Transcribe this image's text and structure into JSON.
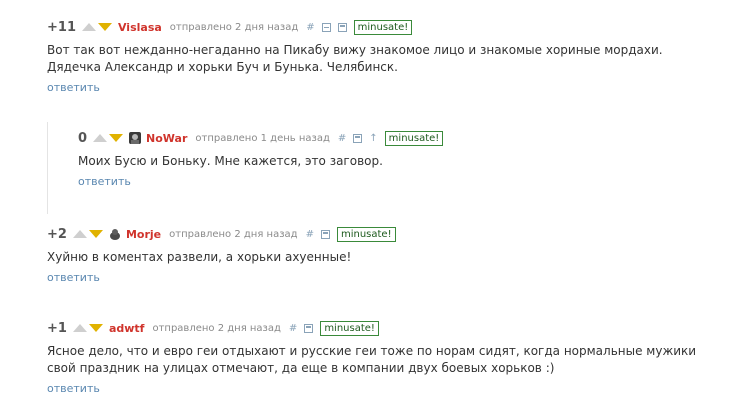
{
  "badge_label": "minusate!",
  "reply_label": "ответить",
  "comments": [
    {
      "rating": "+11",
      "author": "Vislasa",
      "time": "отправлено 2 дня назад",
      "icons": [
        "hash-icon",
        "collapse-icon",
        "save-icon"
      ],
      "text": "Вот так вот нежданно-негаданно на Пикабу вижу знакомое лицо и знакомые хориные мордахи. Дядечка Александр и хорьки Буч и Бунька. Челябинск."
    },
    {
      "rating": "0",
      "author": "NoWar",
      "time": "отправлено 1 день назад",
      "icons": [
        "hash-icon",
        "save-icon",
        "parent-arrow-icon"
      ],
      "text": "Моих Бусю и Боньку. Мне кажется, это заговор."
    },
    {
      "rating": "+2",
      "author": "Morje",
      "time": "отправлено 2 дня назад",
      "icons": [
        "hash-icon",
        "save-icon"
      ],
      "text": "Хуйню в коментах развели, а хорьки ахуенные!"
    },
    {
      "rating": "+1",
      "author": "adwtf",
      "time": "отправлено 2 дня назад",
      "icons": [
        "hash-icon",
        "save-icon"
      ],
      "text": "Ясное дело, что и евро геи отдыхают и русские геи тоже по норам сидят, когда нормальные мужики свой праздник на улицах отмечают, да еще в компании двух боевых хорьков :)"
    }
  ],
  "colors": {
    "author": "#d0342c",
    "link": "#5a87b0",
    "badge_border": "#3a8a3a",
    "downvote": "#e0b200"
  }
}
